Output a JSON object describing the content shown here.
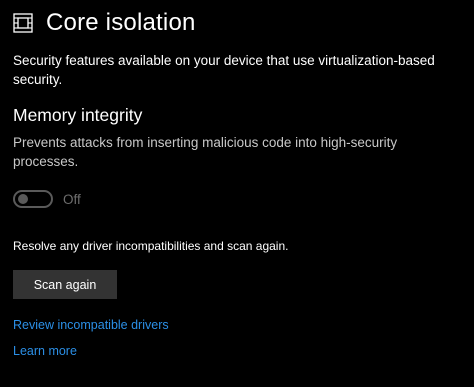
{
  "header": {
    "icon": "chip-icon",
    "title": "Core isolation"
  },
  "intro": {
    "description": "Security features available on your device that use virtualization-based security."
  },
  "memory_integrity": {
    "title": "Memory integrity",
    "description": "Prevents attacks from inserting malicious code into high-security processes.",
    "toggle_state": "Off",
    "toggle_on": false
  },
  "resolve": {
    "text": "Resolve any driver incompatibilities and scan again."
  },
  "actions": {
    "scan_label": "Scan again"
  },
  "links": {
    "review_label": "Review incompatible drivers",
    "learn_label": "Learn more"
  },
  "colors": {
    "background": "#000000",
    "link": "#2b8fe6",
    "button": "#333333",
    "disabled": "#5a5a5a"
  }
}
